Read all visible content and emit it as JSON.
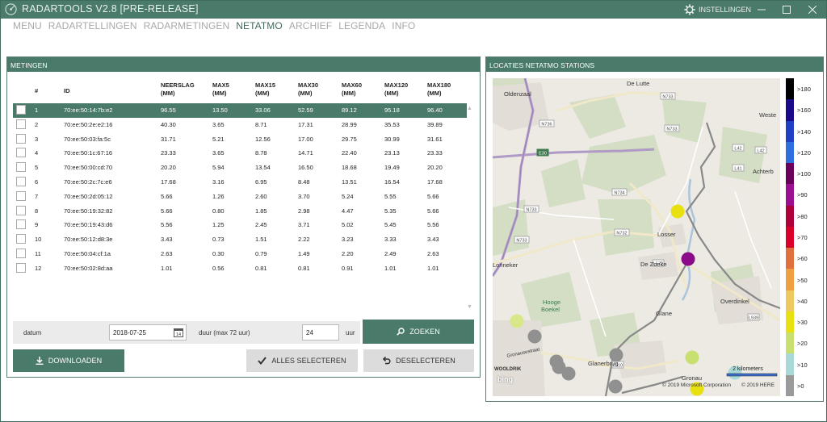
{
  "window": {
    "title": "RADARTOOLS V2.8 [PRE-RELEASE]",
    "settings_label": "INSTELLINGEN",
    "accent": "#4a7a6a"
  },
  "nav": [
    "MENU",
    "RADARTELLINGEN",
    "RADARMETINGEN",
    "NETATMO",
    "ARCHIEF",
    "LEGENDA",
    "INFO"
  ],
  "nav_active": "NETATMO",
  "metingen": {
    "header": "METINGEN",
    "columns": {
      "num": "#",
      "id": "ID",
      "neerslag": [
        "NEERSLAG",
        "(MM)"
      ],
      "max5": [
        "MAX5",
        "(MM)"
      ],
      "max15": [
        "MAX15",
        "(MM)"
      ],
      "max30": [
        "MAX30",
        "(MM)"
      ],
      "max60": [
        "MAX60",
        "(MM)"
      ],
      "max120": [
        "MAX120",
        "(MM)"
      ],
      "max180": [
        "MAX180",
        "(MM)"
      ]
    },
    "rows": [
      {
        "n": "1",
        "id": "70:ee:50:14:7b:e2",
        "neerslag": "96.55",
        "max5": "13.50",
        "max15": "33.06",
        "max30": "52.59",
        "max60": "89.12",
        "max120": "95.18",
        "max180": "96.40",
        "selected": true
      },
      {
        "n": "2",
        "id": "70:ee:50:2e:e2:16",
        "neerslag": "40.30",
        "max5": "3.65",
        "max15": "8.71",
        "max30": "17.31",
        "max60": "28.99",
        "max120": "35.53",
        "max180": "39.89"
      },
      {
        "n": "3",
        "id": "70:ee:50:03:fa:5c",
        "neerslag": "31.71",
        "max5": "5.21",
        "max15": "12.56",
        "max30": "17.00",
        "max60": "29.75",
        "max120": "30.99",
        "max180": "31.61"
      },
      {
        "n": "4",
        "id": "70:ee:50:1c:67:16",
        "neerslag": "23.33",
        "max5": "3.65",
        "max15": "8.78",
        "max30": "14.71",
        "max60": "22.40",
        "max120": "23.13",
        "max180": "23.33"
      },
      {
        "n": "5",
        "id": "70:ee:50:00:cd:70",
        "neerslag": "20.20",
        "max5": "5.94",
        "max15": "13.54",
        "max30": "16.50",
        "max60": "18.68",
        "max120": "19.49",
        "max180": "20.20"
      },
      {
        "n": "6",
        "id": "70:ee:50:2c:7c:e6",
        "neerslag": "17.68",
        "max5": "3.16",
        "max15": "6.95",
        "max30": "8.48",
        "max60": "13.51",
        "max120": "16.54",
        "max180": "17.68"
      },
      {
        "n": "7",
        "id": "70:ee:50:2d:05:12",
        "neerslag": "5.66",
        "max5": "1.26",
        "max15": "2.60",
        "max30": "3.70",
        "max60": "5.24",
        "max120": "5.55",
        "max180": "5.66"
      },
      {
        "n": "8",
        "id": "70:ee:50:19:32:82",
        "neerslag": "5.66",
        "max5": "0.80",
        "max15": "1.85",
        "max30": "2.98",
        "max60": "4.47",
        "max120": "5.35",
        "max180": "5.66"
      },
      {
        "n": "9",
        "id": "70:ee:50:19:43:d6",
        "neerslag": "5.56",
        "max5": "1.25",
        "max15": "2.45",
        "max30": "3.71",
        "max60": "5.02",
        "max120": "5.45",
        "max180": "5.56"
      },
      {
        "n": "10",
        "id": "70:ee:50:12:d8:3e",
        "neerslag": "3.43",
        "max5": "0.73",
        "max15": "1.51",
        "max30": "2.22",
        "max60": "3.23",
        "max120": "3.33",
        "max180": "3.43"
      },
      {
        "n": "11",
        "id": "70:ee:50:04:cf:1a",
        "neerslag": "2.63",
        "max5": "0.30",
        "max15": "0.79",
        "max30": "1.49",
        "max60": "2.20",
        "max120": "2.49",
        "max180": "2.63"
      },
      {
        "n": "12",
        "id": "70:ee:50:02:8d:aa",
        "neerslag": "1.01",
        "max5": "0.56",
        "max15": "0.81",
        "max30": "0.81",
        "max60": "0.91",
        "max120": "1.01",
        "max180": "1.01"
      }
    ]
  },
  "search": {
    "datum_label": "datum",
    "datum_value": "2018-07-25",
    "duur_label": "duur (max 72 uur)",
    "duur_value": "24",
    "uur_label": "uur",
    "zoeken_label": "ZOEKEN"
  },
  "buttons": {
    "download": "DOWNLOADEN",
    "select_all": "ALLES SELECTEREN",
    "deselect": "DESELECTEREN"
  },
  "locaties": {
    "header": "LOCATIES NETATMO STATIONS",
    "places": [
      "De Lutte",
      "Oldenzaal",
      "Weste",
      "Achterb",
      "Losser",
      "De Zoeke",
      "Lonneker",
      "Hooge",
      "Boekel",
      "Overdinkel",
      "Glane",
      "Glanerbrug",
      "Gronau",
      "WOOLDRIK"
    ],
    "roads": [
      "N733",
      "N736",
      "N733",
      "L42",
      "L41",
      "N734",
      "N733",
      "N732",
      "N733",
      "L939",
      "L510",
      "L572",
      "E30",
      "L42"
    ],
    "street": "Gronausestraat",
    "scale_label": "2 kilometers",
    "attribution_ms": "© 2019 Microsoft Corporation",
    "attribution_here": "© 2019 HERE",
    "bing": "bing",
    "legend": [
      {
        "label": ">180",
        "color": "#000000"
      },
      {
        "label": ">160",
        "color": "#1a0a8a"
      },
      {
        "label": ">140",
        "color": "#1f3fc4"
      },
      {
        "label": ">120",
        "color": "#2e6fe0"
      },
      {
        "label": ">100",
        "color": "#6a005a"
      },
      {
        "label": ">90",
        "color": "#9a1090"
      },
      {
        "label": ">80",
        "color": "#b0003a"
      },
      {
        "label": ">70",
        "color": "#d9002a"
      },
      {
        "label": ">60",
        "color": "#e0703e"
      },
      {
        "label": ">50",
        "color": "#f0a040"
      },
      {
        "label": ">40",
        "color": "#f0c860"
      },
      {
        "label": ">30",
        "color": "#e8e010"
      },
      {
        "label": ">20",
        "color": "#c8e070"
      },
      {
        "label": ">10",
        "color": "#a8d8d8"
      },
      {
        "label": ">0",
        "color": "#9a9a9a"
      }
    ],
    "stations": [
      {
        "color": "#e8e010"
      },
      {
        "color": "#8a0a8a"
      },
      {
        "color": "#d8e888"
      },
      {
        "color": "#909090"
      },
      {
        "color": "#c8e070"
      },
      {
        "color": "#909090"
      },
      {
        "color": "#909090"
      },
      {
        "color": "#909090"
      },
      {
        "color": "#909090"
      },
      {
        "color": "#909090"
      },
      {
        "color": "#a8d8d8"
      },
      {
        "color": "#e8e010"
      }
    ]
  }
}
